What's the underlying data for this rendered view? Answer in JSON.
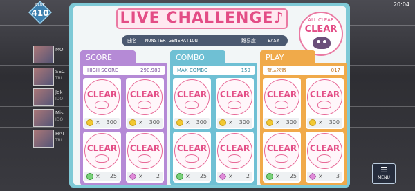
{
  "background": {
    "rank_label": "RANK",
    "rank_value": "410",
    "time": "20:04",
    "menu_label": "MENU",
    "songs": [
      {
        "title": "MO"
      },
      {
        "title": "SEC",
        "sub": "TRI"
      },
      {
        "title": "Jok",
        "sub": "IDO"
      },
      {
        "title": "Mis",
        "sub": "IDO"
      },
      {
        "title": "HAT",
        "sub": "TRI"
      }
    ]
  },
  "dialog": {
    "title": "LIVE CHALLENGE♪",
    "song_label": "曲名",
    "song_name": "MONSTER GENERATION",
    "difficulty_label": "難易度",
    "difficulty": "EASY",
    "medal": {
      "top": "ALL CLEAR",
      "main": "CLEAR"
    },
    "columns": [
      {
        "key": "score",
        "header": "SCORE",
        "stat_name": "HIGH SCORE",
        "stat_value": "290,989",
        "cards": [
          {
            "reward_icon": "coin-icon",
            "multiplier": "×",
            "reward": "300"
          },
          {
            "reward_icon": "coin-icon",
            "multiplier": "×",
            "reward": "300"
          },
          {
            "reward_icon": "ticket-icon",
            "multiplier": "×",
            "reward": "25"
          },
          {
            "reward_icon": "gem-icon",
            "multiplier": "×",
            "reward": "2"
          }
        ]
      },
      {
        "key": "combo",
        "header": "COMBO",
        "stat_name": "MAX COMBO",
        "stat_value": "159",
        "cards": [
          {
            "reward_icon": "coin-icon",
            "multiplier": "×",
            "reward": "300"
          },
          {
            "reward_icon": "coin-icon",
            "multiplier": "×",
            "reward": "300"
          },
          {
            "reward_icon": "ticket-icon",
            "multiplier": "×",
            "reward": "25"
          },
          {
            "reward_icon": "gem-icon",
            "multiplier": "×",
            "reward": "2"
          }
        ]
      },
      {
        "key": "play",
        "header": "PLAY",
        "stat_name": "遊玩次數",
        "stat_value": "017",
        "cards": [
          {
            "reward_icon": "coin-icon",
            "multiplier": "×",
            "reward": "300"
          },
          {
            "reward_icon": "coin-icon",
            "multiplier": "×",
            "reward": "300"
          },
          {
            "reward_icon": "ticket-icon",
            "multiplier": "×",
            "reward": "25"
          },
          {
            "reward_icon": "gem-icon",
            "multiplier": "×",
            "reward": "3"
          }
        ]
      }
    ],
    "stamp_text": "CLEAR"
  }
}
